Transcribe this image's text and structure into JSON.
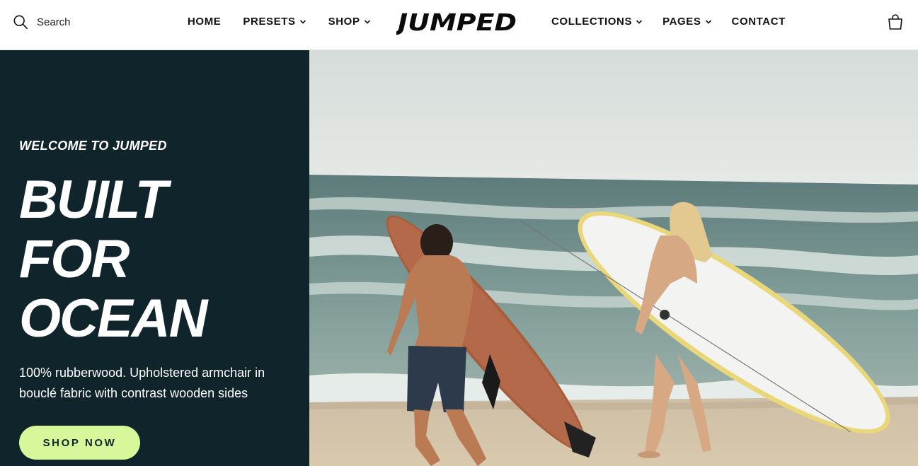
{
  "header": {
    "search_label": "Search",
    "logo_text": "JUMPED",
    "nav_left": [
      {
        "label": "HOME",
        "has_dropdown": false
      },
      {
        "label": "PRESETS",
        "has_dropdown": true
      },
      {
        "label": "SHOP",
        "has_dropdown": true
      }
    ],
    "nav_right": [
      {
        "label": "COLLECTIONS",
        "has_dropdown": true
      },
      {
        "label": "PAGES",
        "has_dropdown": true
      },
      {
        "label": "CONTACT",
        "has_dropdown": false
      }
    ],
    "icons": {
      "search": "search-icon",
      "cart": "shopping-bag-icon",
      "dropdown": "chevron-down-icon"
    }
  },
  "hero": {
    "eyebrow": "WELCOME TO JUMPED",
    "headline": [
      "BUILT",
      "FOR",
      "OCEAN"
    ],
    "description": "100% rubberwood. Upholstered armchair in bouclé fabric with contrast wooden sides",
    "cta_label": "SHOP NOW",
    "image_subject": "surfers-on-beach"
  },
  "colors": {
    "panel": "#10242c",
    "accent": "#d8f79b",
    "text_on_dark": "#ffffff"
  }
}
